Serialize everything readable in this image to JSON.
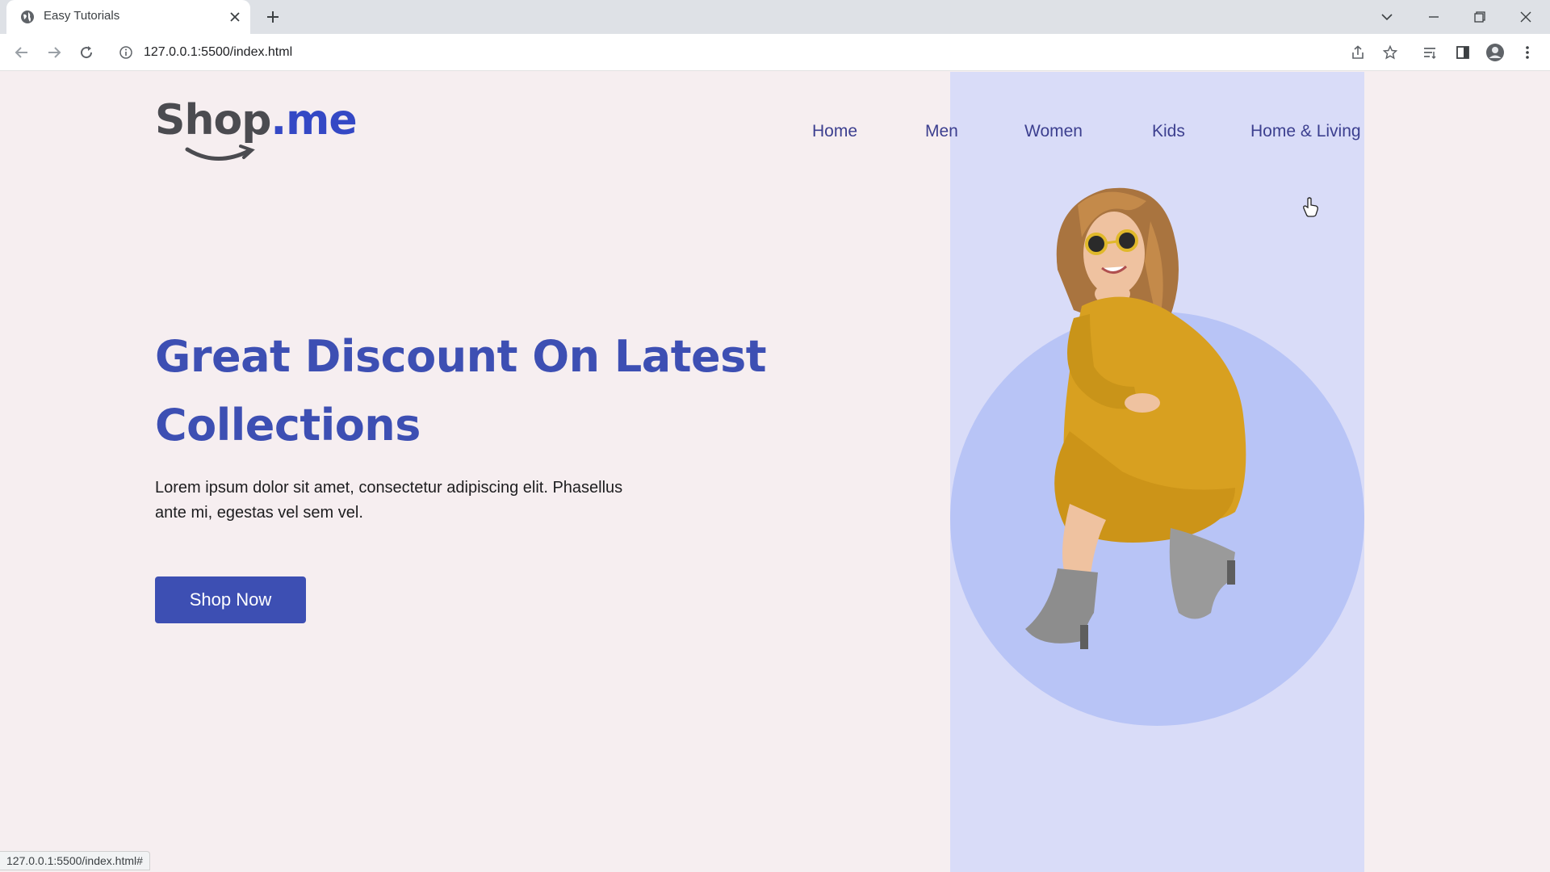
{
  "browser": {
    "tab_title": "Easy Tutorials",
    "url": "127.0.0.1:5500/index.html",
    "status_url": "127.0.0.1:5500/index.html#"
  },
  "logo": {
    "part1": "Shop",
    "part2": ".me"
  },
  "nav": {
    "items": [
      "Home",
      "Men",
      "Women",
      "Kids",
      "Home & Living"
    ]
  },
  "hero": {
    "headline_line1": "Great Discount On Latest",
    "headline_line2": "Collections",
    "desc_line1": "Lorem ipsum dolor sit amet, consectetur adipiscing elit. Phasellus",
    "desc_line2": "ante mi, egestas vel sem vel.",
    "cta": "Shop Now"
  },
  "colors": {
    "brand": "#3d4fb3",
    "page_bg": "#f6eef0",
    "panel": "#d9dcf8",
    "circle": "#b8c4f6",
    "dress": "#d8a020"
  },
  "icons": [
    "globe-icon",
    "close-icon",
    "plus-icon",
    "back-icon",
    "forward-icon",
    "reload-icon",
    "info-icon",
    "share-icon",
    "star-icon",
    "reading-list-icon",
    "side-panel-icon",
    "profile-icon",
    "menu-icon"
  ]
}
